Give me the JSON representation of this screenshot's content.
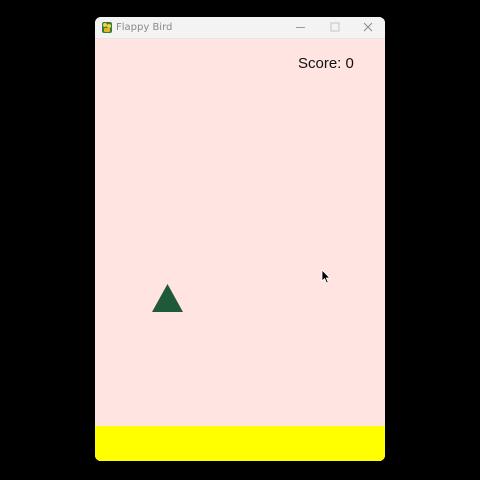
{
  "window": {
    "title": "Flappy Bird",
    "icon": "pygame-snake-icon"
  },
  "game": {
    "score_text": "Score: 0",
    "background_color": "#ffe4e1",
    "bird_color": "#1e5a3a",
    "ground_color": "#ffff00"
  }
}
